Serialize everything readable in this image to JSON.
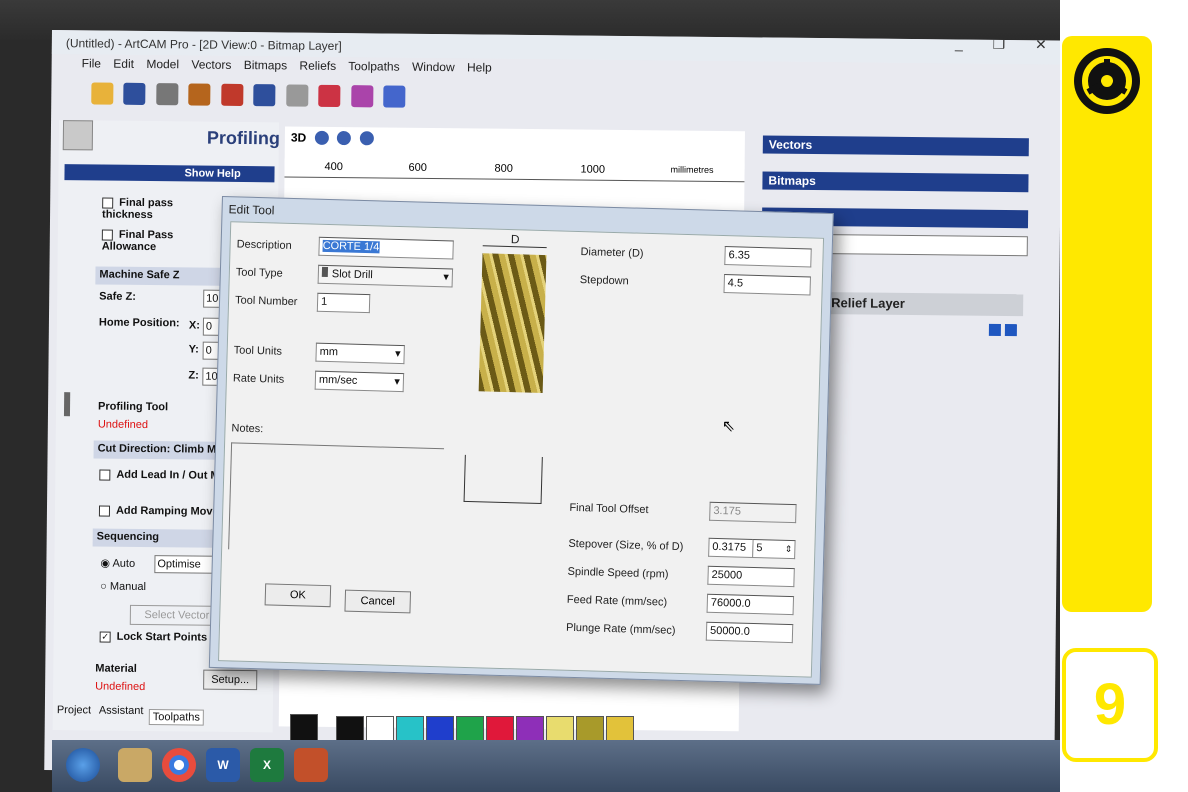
{
  "window": {
    "title": "(Untitled) - ArtCAM Pro - [2D View:0 - Bitmap Layer]",
    "min": "_",
    "restore": "❐",
    "close": "✕"
  },
  "menu": [
    "File",
    "Edit",
    "Model",
    "Vectors",
    "Bitmaps",
    "Reliefs",
    "Toolpaths",
    "Window",
    "Help"
  ],
  "left_panel": {
    "title": "Profiling",
    "show_help": "Show Help",
    "final_pass_thickness": "Final pass thickness",
    "final_pass_allowance": "Final Pass Allowance",
    "machine_safe_z": "Machine Safe Z",
    "safe_z_label": "Safe Z:",
    "safe_z_value": "10",
    "home_position": "Home Position:",
    "x_label": "X:",
    "x_value": "0",
    "y_label": "Y:",
    "y_value": "0",
    "z_label": "Z:",
    "z_value": "10",
    "profiling_tool": "Profiling Tool",
    "tool_undefined": "Undefined",
    "cut_direction": "Cut Direction: Climb Mill",
    "lead_in": "Add Lead In / Out Moves",
    "ramping": "Add Ramping Moves",
    "sequencing": "Sequencing",
    "auto": "Auto",
    "optimise": "Optimise",
    "manual": "Manual",
    "select_vector": "Select Vector",
    "lock_start": "Lock Start Points",
    "material": "Material",
    "material_undefined": "Undefined",
    "setup": "Setup...",
    "tabs": [
      "Project",
      "Assistant",
      "Toolpaths"
    ]
  },
  "ruler": {
    "ticks": [
      "400",
      "600",
      "800",
      "1000"
    ],
    "unit": "millimetres"
  },
  "right_panel": {
    "vectors": "Vectors",
    "bitmaps": "Bitmaps",
    "relief_layer": "Relief Layer"
  },
  "dialog": {
    "title": "Edit Tool",
    "description_label": "Description",
    "description_value": "CORTE 1/4",
    "tool_type_label": "Tool Type",
    "tool_type_value": "Slot Drill",
    "tool_number_label": "Tool Number",
    "tool_number_value": "1",
    "tool_units_label": "Tool Units",
    "tool_units_value": "mm",
    "rate_units_label": "Rate Units",
    "rate_units_value": "mm/sec",
    "notes_label": "Notes:",
    "diagram_label": "D",
    "diameter_label": "Diameter (D)",
    "diameter_value": "6.35",
    "stepdown_label": "Stepdown",
    "stepdown_value": "4.5",
    "final_offset_label": "Final Tool Offset",
    "final_offset_value": "3.175",
    "stepover_label": "Stepover (Size, % of D)",
    "stepover_value": "0.3175",
    "stepover_pct": "5",
    "spindle_label": "Spindle Speed (rpm)",
    "spindle_value": "25000",
    "feed_label": "Feed Rate (mm/sec)",
    "feed_value": "76000.0",
    "plunge_label": "Plunge Rate (mm/sec)",
    "plunge_value": "50000.0",
    "ok": "OK",
    "cancel": "Cancel"
  },
  "page_number": "9",
  "colors": {
    "brand_yellow": "#ffe800",
    "title_blue": "#1f3e8c"
  }
}
